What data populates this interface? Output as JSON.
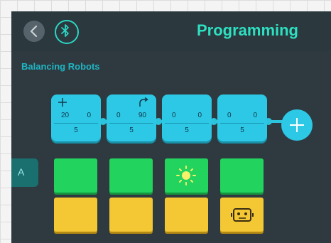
{
  "header": {
    "title": "Programming",
    "back_icon": "chevron-left-icon",
    "bluetooth_icon": "bluetooth-icon"
  },
  "subtitle": "Balancing Robots",
  "tab": {
    "label": "A"
  },
  "blocks": [
    {
      "motor": {
        "icon": "plus-icon",
        "left": "20",
        "right": "0",
        "duration": "5"
      },
      "sensor": null,
      "action": null
    },
    {
      "motor": {
        "icon": "turn-arrow-icon",
        "left": "0",
        "right": "90",
        "duration": "5"
      },
      "sensor": null,
      "action": null
    },
    {
      "motor": {
        "icon": null,
        "left": "0",
        "right": "0",
        "duration": "5"
      },
      "sensor": "light-icon",
      "action": null
    },
    {
      "motor": {
        "icon": null,
        "left": "0",
        "right": "0",
        "duration": "5"
      },
      "sensor": null,
      "action": "robot-face-icon"
    }
  ],
  "add_icon": "plus-icon",
  "colors": {
    "background": "#2e3a3f",
    "accent_title": "#2ee0c2",
    "motor_block": "#2cc8e6",
    "sensor_block": "#22d35e",
    "action_block": "#f4c734"
  }
}
